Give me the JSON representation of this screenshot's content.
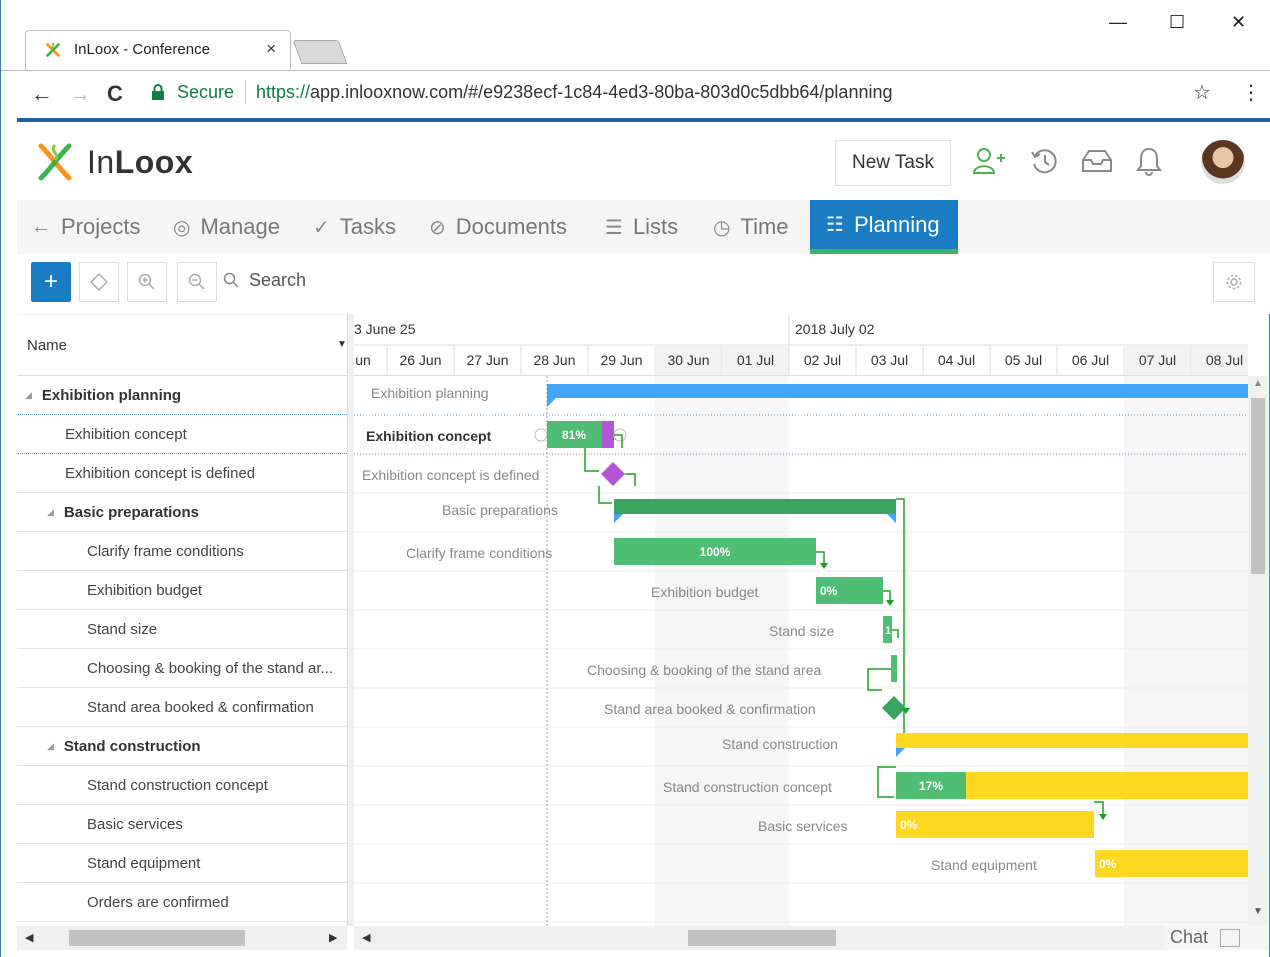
{
  "browser": {
    "tab_title": "InLoox - Conference",
    "tab_close": "×",
    "minimize": "—",
    "maximize": "☐",
    "close": "✕",
    "back": "←",
    "forward": "→",
    "reload": "C",
    "secure_label": "Secure",
    "url_scheme": "https://",
    "url_rest": "app.inlooxnow.com/#/e9238ecf-1c84-4ed3-80ba-803d0c5dbb64/planning",
    "bookmark": "☆",
    "menu": "⋮"
  },
  "app": {
    "brand_light": "In",
    "brand_bold": "Loox",
    "new_task": "New Task",
    "accent": "#1a7dc4"
  },
  "nav": {
    "items": [
      {
        "label": "Projects",
        "icon": "←"
      },
      {
        "label": "Manage",
        "icon": "◎"
      },
      {
        "label": "Tasks",
        "icon": "✓"
      },
      {
        "label": "Documents",
        "icon": "⊘"
      },
      {
        "label": "Lists",
        "icon": "☰"
      },
      {
        "label": "Time",
        "icon": "◷"
      },
      {
        "label": "Planning",
        "icon": "☷"
      }
    ]
  },
  "toolbar": {
    "add": "+",
    "search": "Search"
  },
  "grid": {
    "header": "Name",
    "rows": [
      {
        "label": "Exhibition planning",
        "level": 0,
        "group": true
      },
      {
        "label": "Exhibition concept",
        "level": 1,
        "group": false
      },
      {
        "label": "Exhibition concept is defined",
        "level": 1,
        "group": false
      },
      {
        "label": "Basic preparations",
        "level": 1,
        "group": true
      },
      {
        "label": "Clarify frame conditions",
        "level": 2,
        "group": false
      },
      {
        "label": "Exhibition budget",
        "level": 2,
        "group": false
      },
      {
        "label": "Stand size",
        "level": 2,
        "group": false
      },
      {
        "label": "Choosing & booking of the stand ar...",
        "level": 2,
        "group": false
      },
      {
        "label": "Stand area booked & confirmation",
        "level": 2,
        "group": false
      },
      {
        "label": "Stand construction",
        "level": 1,
        "group": true
      },
      {
        "label": "Stand construction concept",
        "level": 2,
        "group": false
      },
      {
        "label": "Basic services",
        "level": 2,
        "group": false
      },
      {
        "label": "Stand equipment",
        "level": 2,
        "group": false
      },
      {
        "label": "Orders are confirmed",
        "level": 2,
        "group": false
      }
    ]
  },
  "timeline": {
    "weeks": [
      "3 June 25",
      "2018 July 02"
    ],
    "days": [
      "un",
      "26 Jun",
      "27 Jun",
      "28 Jun",
      "29 Jun",
      "30 Jun",
      "01 Jul",
      "02 Jul",
      "03 Jul",
      "04 Jul",
      "05 Jul",
      "06 Jul",
      "07 Jul",
      "08 Jul"
    ],
    "weekend_days": [
      5,
      6,
      12,
      13
    ]
  },
  "gantt": {
    "colors": {
      "summary_blue": "#42a5f5",
      "green": "#4fbe74",
      "green_dark": "#3aa55f",
      "yellow": "#ffd620",
      "purple": "#b455d6",
      "label": "#888"
    },
    "tasks": [
      {
        "label": "Exhibition planning",
        "type": "summary",
        "color": "summary_blue"
      },
      {
        "label": "Exhibition concept",
        "type": "task",
        "progress": "81%",
        "color": "green"
      },
      {
        "label": "Exhibition concept is defined",
        "type": "milestone",
        "color": "purple"
      },
      {
        "label": "Basic preparations",
        "type": "summary",
        "color": "green_dark"
      },
      {
        "label": "Clarify frame conditions",
        "type": "task",
        "progress": "100%",
        "color": "green"
      },
      {
        "label": "Exhibition budget",
        "type": "task",
        "progress": "0%",
        "color": "green"
      },
      {
        "label": "Stand size",
        "type": "task",
        "progress": "1",
        "color": "green"
      },
      {
        "label": "Choosing & booking of the stand area",
        "type": "task",
        "progress": "",
        "color": "green"
      },
      {
        "label": "Stand area booked & confirmation",
        "type": "milestone",
        "color": "green_dark"
      },
      {
        "label": "Stand construction",
        "type": "summary",
        "color": "yellow"
      },
      {
        "label": "Stand construction concept",
        "type": "task",
        "progress": "17%",
        "color": "yellow"
      },
      {
        "label": "Basic services",
        "type": "task",
        "progress": "0%",
        "color": "yellow"
      },
      {
        "label": "Stand equipment",
        "type": "task",
        "progress": "0%",
        "color": "yellow"
      }
    ]
  },
  "footer": {
    "chat": "Chat"
  }
}
